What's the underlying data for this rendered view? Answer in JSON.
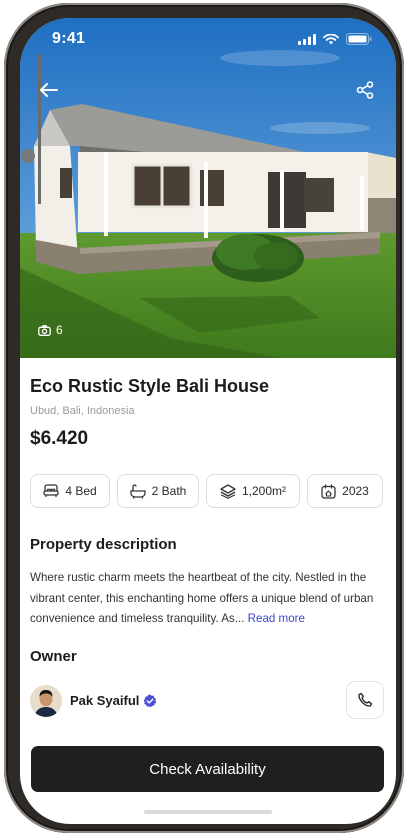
{
  "status_bar": {
    "time": "9:41"
  },
  "hero": {
    "photo_count": "6"
  },
  "property": {
    "title": "Eco Rustic Style Bali House",
    "location": "Ubud, Bali, Indonesia",
    "price": "$6.420"
  },
  "specs": [
    {
      "icon": "bed-icon",
      "label": "4 Bed"
    },
    {
      "icon": "bathtub-icon",
      "label": "2 Bath"
    },
    {
      "icon": "layers-icon",
      "label": "1,200m²"
    },
    {
      "icon": "calendar-icon",
      "label": "2023"
    }
  ],
  "description": {
    "heading": "Property description",
    "text": "Where rustic charm meets the heartbeat of the city. Nestled in the vibrant center, this enchanting home offers a unique blend of urban convenience and timeless tranquility. As...",
    "read_more": "Read more"
  },
  "owner": {
    "heading": "Owner",
    "name": "Pak Syaiful",
    "verified": true
  },
  "cta": {
    "label": "Check Availability"
  },
  "colors": {
    "accent": "#3b46c4",
    "cta_background": "#1f1f1f",
    "verified_badge": "#4a4fd6"
  }
}
